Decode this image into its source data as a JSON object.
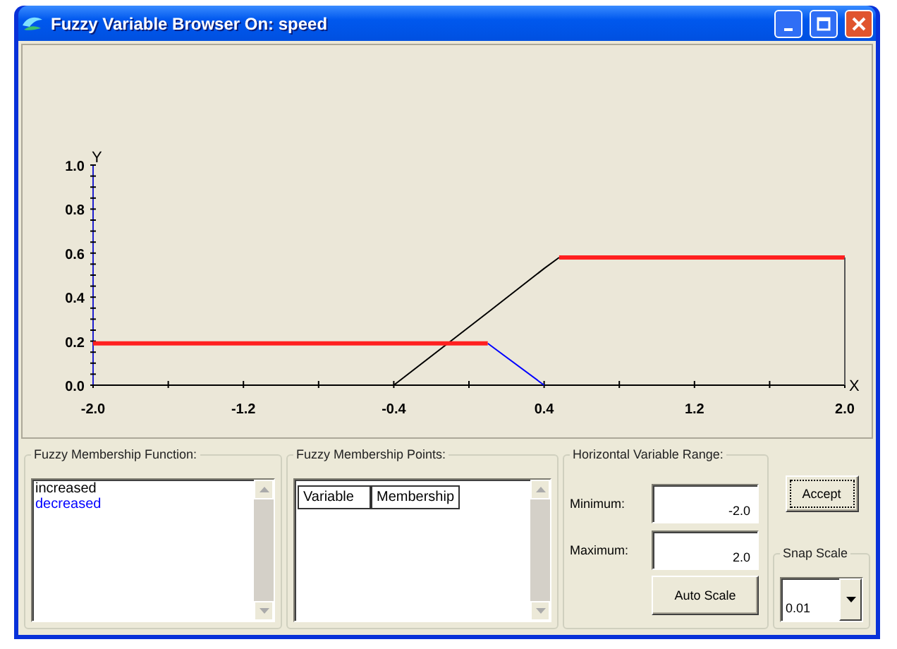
{
  "window": {
    "title": "Fuzzy Variable Browser On: speed"
  },
  "chart": {
    "chart_data": {
      "type": "line",
      "xlabel": "X",
      "ylabel": "Y",
      "x": [
        -2.0,
        -0.4,
        0.1,
        0.4,
        0.48,
        2.0
      ],
      "series": [
        {
          "color": "#000000",
          "values": [
            null,
            0.0,
            0.33,
            0.53,
            0.58,
            null
          ]
        },
        {
          "color": "#0000ff",
          "values": [
            null,
            null,
            0.19,
            0.0,
            null,
            null
          ]
        },
        {
          "color": "#ff2020",
          "values": [
            0.19,
            0.19,
            0.19,
            null,
            0.58,
            0.58
          ]
        }
      ],
      "xlim": [
        -2.0,
        2.0
      ],
      "ylim": [
        0,
        1.0
      ],
      "xticks": [
        {
          "value": -2.0,
          "label": "-2.0"
        },
        {
          "value": -1.2,
          "label": "-1.2"
        },
        {
          "value": -0.4,
          "label": "-0.4"
        },
        {
          "value": 0.4,
          "label": "0.4"
        },
        {
          "value": 1.2,
          "label": "1.2"
        },
        {
          "value": 2.0,
          "label": "2.0"
        }
      ],
      "yticks": [
        {
          "value": 0,
          "label": "0.0"
        },
        {
          "value": 0.2,
          "label": "0.2"
        },
        {
          "value": 0.4,
          "label": "0.4"
        },
        {
          "value": 0.6,
          "label": "0.6"
        },
        {
          "value": 0.8,
          "label": "0.8"
        },
        {
          "value": 1.0,
          "label": "1.0"
        }
      ]
    }
  },
  "membership_function": {
    "label": "Fuzzy Membership Function:",
    "items": [
      {
        "label": "increased",
        "color": "#000000"
      },
      {
        "label": "decreased",
        "color": "#0000ff"
      }
    ]
  },
  "membership_points": {
    "label": "Fuzzy Membership Points:",
    "columns": [
      "Variable",
      "Membership"
    ]
  },
  "range": {
    "label": "Horizontal Variable Range:",
    "minimum": {
      "label": "Minimum:",
      "value": "-2.0"
    },
    "maximum": {
      "label": "Maximum:",
      "value": "2.0"
    },
    "auto_scale": "Auto Scale"
  },
  "accept": "Accept",
  "snap_scale": {
    "label": "Snap Scale",
    "value": "0.01"
  }
}
